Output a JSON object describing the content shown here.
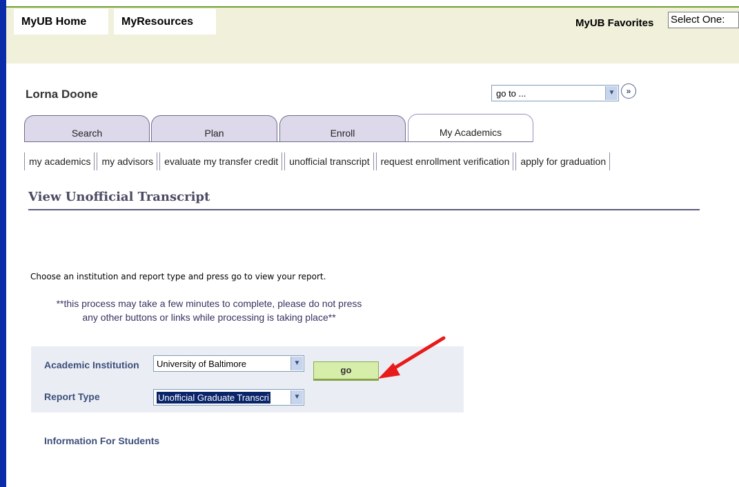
{
  "top_nav": {
    "home": "MyUB Home",
    "resources": "MyResources",
    "favorites_label": "MyUB Favorites",
    "favorites_select": "Select One:"
  },
  "user": {
    "name": "Lorna Doone"
  },
  "goto": {
    "value": "go to ...",
    "button": "»"
  },
  "tabs": [
    "Search",
    "Plan",
    "Enroll",
    "My Academics"
  ],
  "active_tab": "My Academics",
  "subnav": [
    "my academics",
    "my advisors",
    "evaluate my transfer credit",
    "unofficial transcript",
    "request enrollment verification",
    "apply for graduation"
  ],
  "page": {
    "title": "View Unofficial Transcript",
    "instructions": "Choose an institution and report type and press go to view your report.",
    "warning_line1": "**this process may take a few minutes to complete, please do not press",
    "warning_line2": "any other buttons or links while processing is taking place**"
  },
  "form": {
    "institution_label": "Academic Institution",
    "institution_value": "University of Baltimore",
    "report_label": "Report Type",
    "report_value": "Unofficial Graduate Transcri",
    "go_label": "go"
  },
  "links": {
    "info_students": "Information For Students"
  },
  "colors": {
    "accent_green": "#6aa02e",
    "left_bar": "#0a2ca8",
    "annotation_arrow": "#e81a1a",
    "go_button": "#d7edaa"
  },
  "icons": [
    "chevron-down-icon",
    "double-chevron-right-icon",
    "red-arrow-annotation"
  ]
}
